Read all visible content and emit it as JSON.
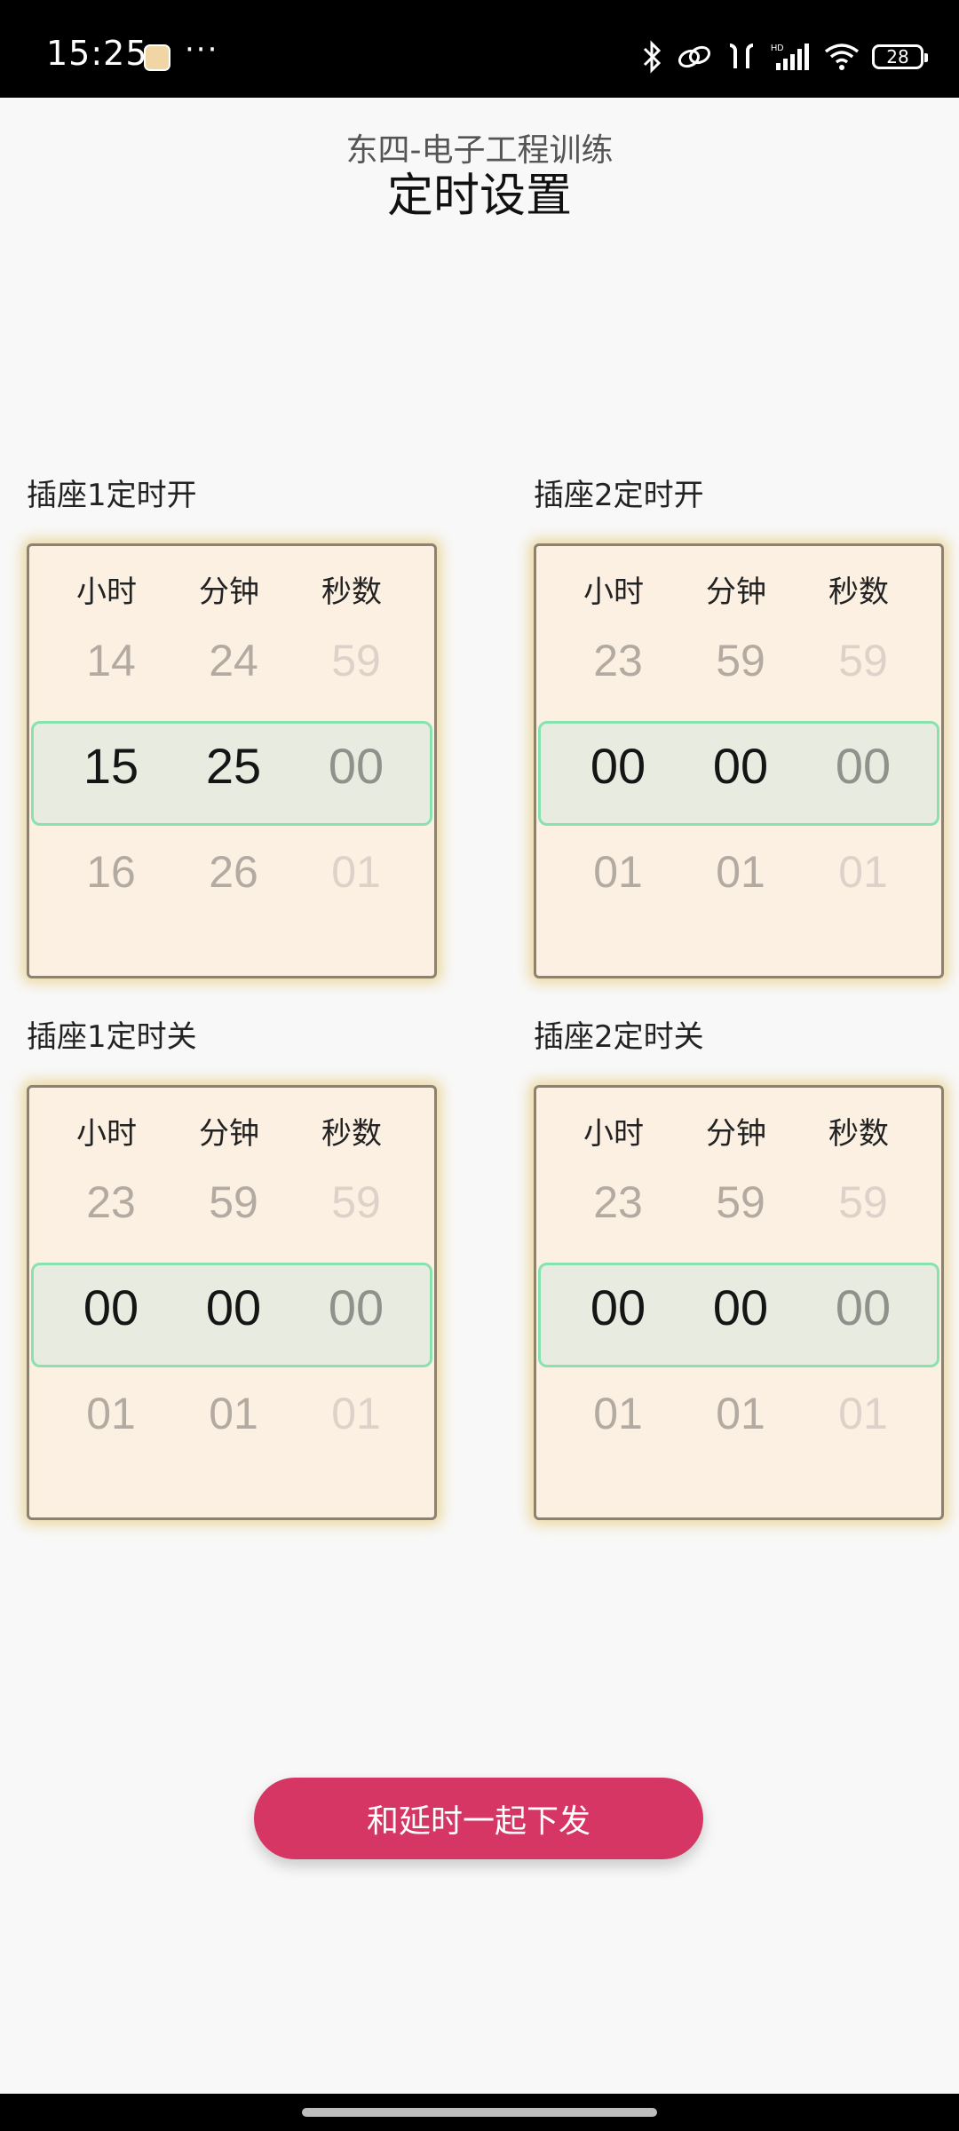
{
  "status_bar": {
    "time": "15:25",
    "more": "···",
    "battery": "28",
    "icons": [
      "app-notification-icon",
      "bluetooth-icon",
      "link-icon",
      "earbuds-icon",
      "hd-signal-icon",
      "wifi-icon",
      "battery-icon"
    ]
  },
  "header": {
    "subtitle": "东四-电子工程训练",
    "title": "定时设置"
  },
  "column_headers": [
    "小时",
    "分钟",
    "秒数"
  ],
  "timers": [
    {
      "label": "插座1定时开",
      "prev": [
        "14",
        "24",
        "59"
      ],
      "selected": [
        "15",
        "25",
        "00"
      ],
      "next": [
        "16",
        "26",
        "01"
      ]
    },
    {
      "label": "插座2定时开",
      "prev": [
        "23",
        "59",
        "59"
      ],
      "selected": [
        "00",
        "00",
        "00"
      ],
      "next": [
        "01",
        "01",
        "01"
      ]
    },
    {
      "label": "插座1定时关",
      "prev": [
        "23",
        "59",
        "59"
      ],
      "selected": [
        "00",
        "00",
        "00"
      ],
      "next": [
        "01",
        "01",
        "01"
      ]
    },
    {
      "label": "插座2定时关",
      "prev": [
        "23",
        "59",
        "59"
      ],
      "selected": [
        "00",
        "00",
        "00"
      ],
      "next": [
        "01",
        "01",
        "01"
      ]
    }
  ],
  "action_button": "和延时一起下发",
  "colors": {
    "card_bg": "#fbf0e2",
    "selection_bg": "#e8ebdf",
    "selection_border": "#88e2b0",
    "button": "#d53664"
  }
}
